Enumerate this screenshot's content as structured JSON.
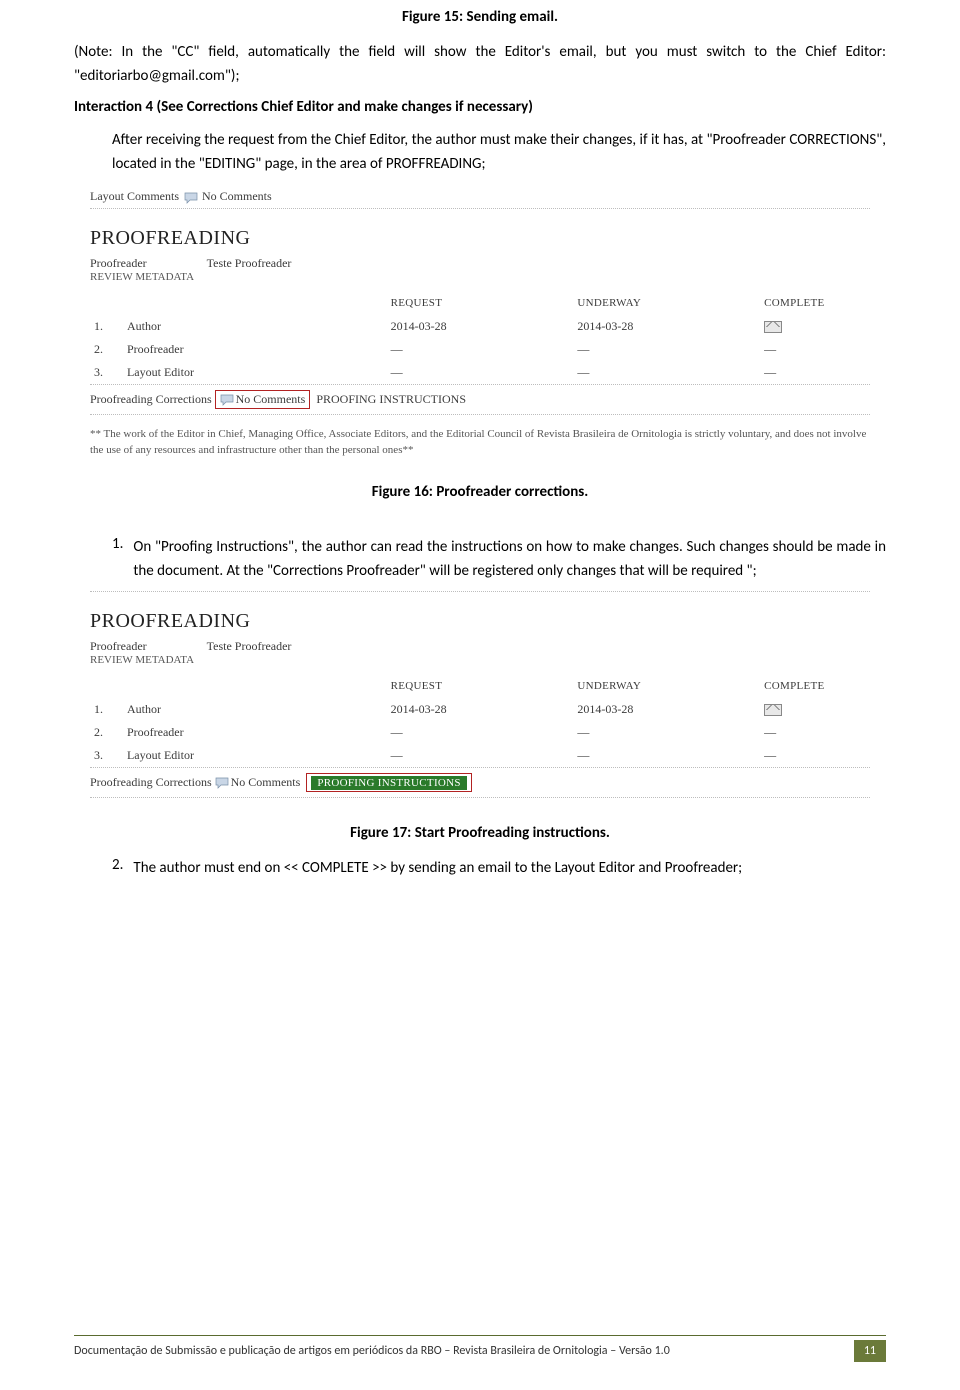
{
  "caption_top": "Figure 15: Sending email.",
  "note_text": "(Note: In the \"CC\" field, automatically the field will show the Editor's email, but you must switch to the Chief Editor: \"editoriarbo@gmail.com\");",
  "interaction_heading": "Interaction 4 (See Corrections Chief Editor and make changes if necessary)",
  "interaction_body": "After receiving the request from the Chief Editor, the author must make their changes, if it has, at \"Proofreader CORRECTIONS\", located in the \"EDITING\" page, in the area of PROFFREADING;",
  "screenshot1": {
    "layout_comments_label": "Layout Comments",
    "no_comments": "No Comments",
    "heading": "PROOFREADING",
    "proofreader_label": "Proofreader",
    "proofreader_name": "Teste Proofreader",
    "review_meta": "REVIEW METADATA",
    "th_request": "REQUEST",
    "th_underway": "UNDERWAY",
    "th_complete": "COMPLETE",
    "rows": [
      {
        "n": "1.",
        "role": "Author",
        "req": "2014-03-28",
        "under": "2014-03-28",
        "comp": "env"
      },
      {
        "n": "2.",
        "role": "Proofreader",
        "req": "—",
        "under": "—",
        "comp": "—"
      },
      {
        "n": "3.",
        "role": "Layout Editor",
        "req": "—",
        "under": "—",
        "comp": "—"
      }
    ],
    "corrections_label": "Proofreading Corrections",
    "proofing_instructions": "PROOFING INSTRUCTIONS",
    "footnote": "** The work of the Editor in Chief, Managing Office, Associate Editors, and the Editorial Council of Revista Brasileira de Ornitologia is strictly voluntary, and does not involve the use of any resources and infrastructure other than the personal ones**"
  },
  "caption_fig16": "Figure 16: Proofreader corrections.",
  "item1_num": "1.",
  "item1_text": "On \"Proofing Instructions\", the author can read the instructions on how to make changes. Such changes should be made in the document. At the \"Corrections Proofreader\" will be registered only changes that will be required \";",
  "caption_fig17": "Figure 17: Start Proofreading instructions.",
  "item2_num": "2.",
  "item2_text": "The author must end on << COMPLETE >>  by sending an email to the Layout Editor and Proofreader;",
  "footer_text": "Documentação de Submissão e publicação de artigos em periódicos da RBO – Revista Brasileira de Ornitologia – Versão 1.0",
  "footer_page": "11"
}
